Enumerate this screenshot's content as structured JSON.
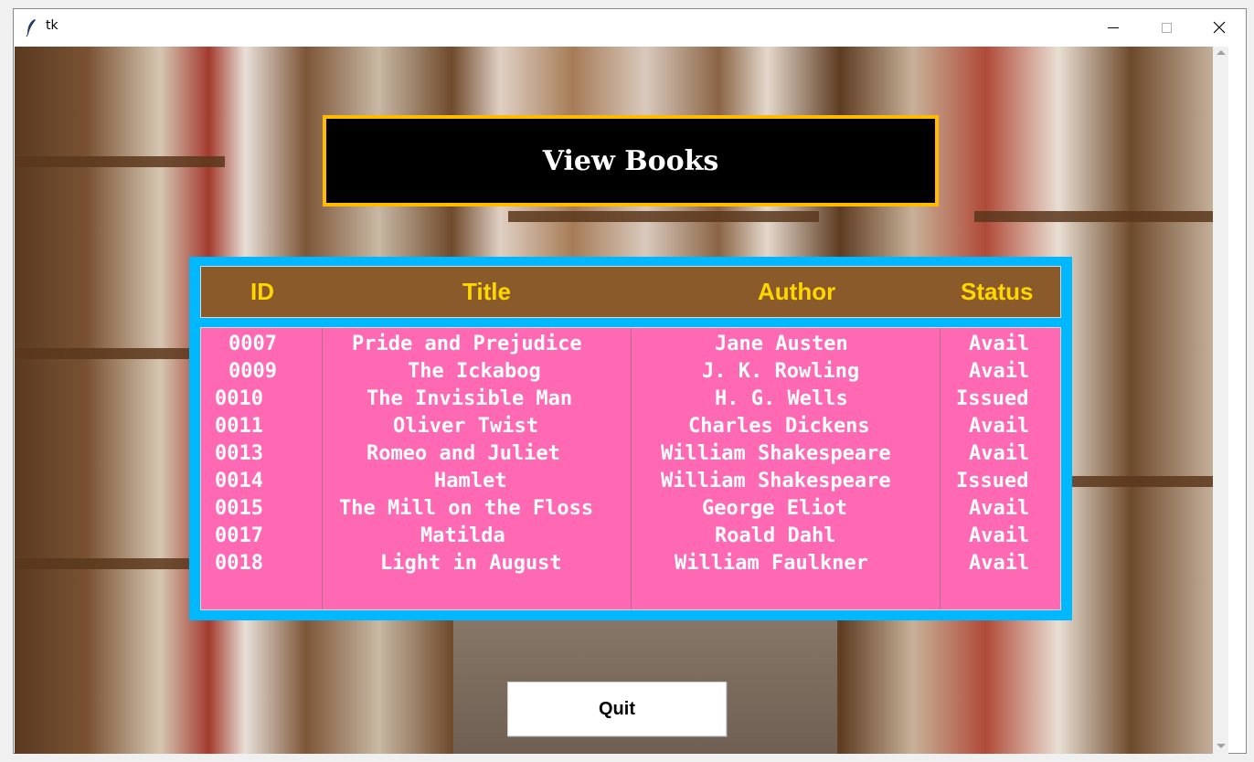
{
  "window": {
    "title": "tk",
    "icon": "feather-icon",
    "controls": [
      "minimize-icon",
      "maximize-icon",
      "close-icon"
    ]
  },
  "heading": "View Books",
  "table": {
    "columns": [
      "ID",
      "Title",
      "Author",
      "Status"
    ],
    "rows": [
      [
        "0007",
        "Pride and Prejudice",
        "Jane Austen",
        "Avail"
      ],
      [
        "0009",
        "The Ickabog",
        "J. K. Rowling",
        "Avail"
      ],
      [
        "0010",
        "The Invisible Man",
        "H. G. Wells",
        "Issued"
      ],
      [
        "0011",
        "Oliver Twist",
        "Charles Dickens",
        "Avail"
      ],
      [
        "0013",
        "Romeo and Juliet",
        "William Shakespeare",
        "Avail"
      ],
      [
        "0014",
        "Hamlet",
        "William Shakespeare",
        "Issued"
      ],
      [
        "0015",
        "The Mill on the Floss",
        "George Eliot",
        "Avail"
      ],
      [
        "0017",
        "Matilda",
        "Roald Dahl",
        "Avail"
      ],
      [
        "0018",
        "Light in August",
        "William Faulkner",
        "Avail"
      ]
    ]
  },
  "quit_label": "Quit",
  "colors": {
    "heading_bg": "#000000",
    "heading_border": "#ffbb00",
    "list_frame": "#00b8ff",
    "header_bg": "#8b5a2b",
    "header_text": "#ffd700",
    "body_bg": "#ff69b4",
    "body_text": "#ffffff"
  }
}
